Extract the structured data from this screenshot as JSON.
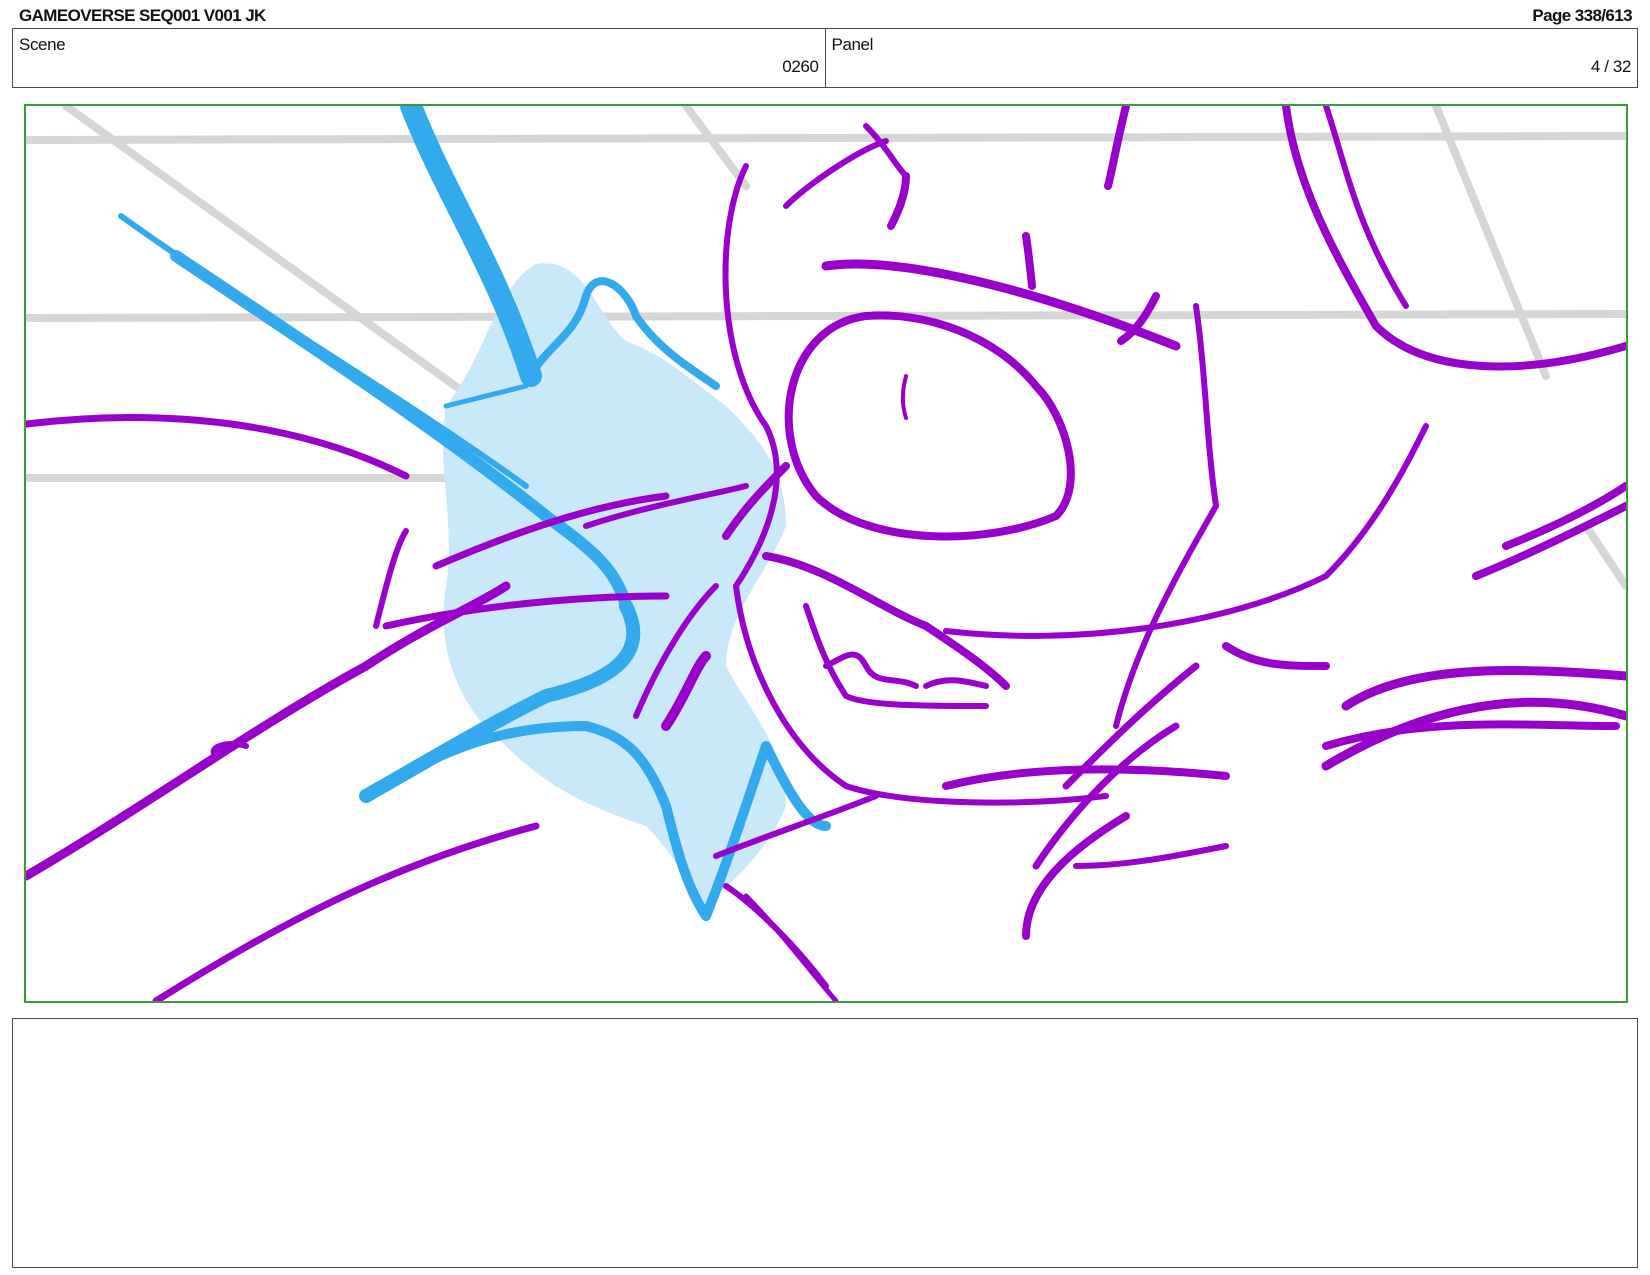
{
  "header": {
    "title": "GAMEOVERSE SEQ001 V001 JK",
    "page": "Page 338/613"
  },
  "scene": {
    "label": "Scene",
    "value": "0260"
  },
  "panel": {
    "label": "Panel",
    "value": "4 / 32"
  },
  "colors": {
    "frame_border": "#3c9a3c",
    "sketch_purple": "#9900cc",
    "effect_blue": "#33aaee",
    "effect_fill": "#c9e8fa",
    "guide_grey": "#d6d6d6"
  },
  "notes": {
    "text": ""
  }
}
